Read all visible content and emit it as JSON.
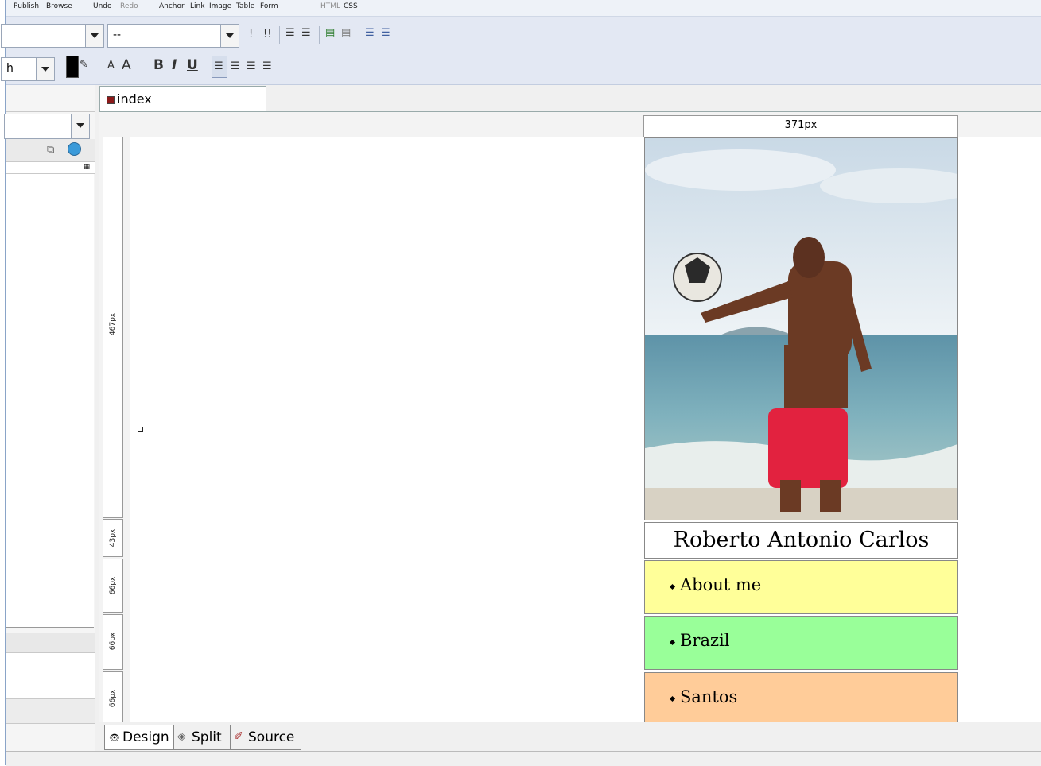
{
  "menubar": {
    "items": [
      {
        "label": "Publish",
        "enabled": true
      },
      {
        "label": "Browse",
        "enabled": true
      },
      {
        "label": "Undo",
        "enabled": true
      },
      {
        "label": "Redo",
        "enabled": false
      },
      {
        "label": "Anchor",
        "enabled": true
      },
      {
        "label": "Link",
        "enabled": true
      },
      {
        "label": "Image",
        "enabled": true
      },
      {
        "label": "Table",
        "enabled": true
      },
      {
        "label": "Form",
        "enabled": true
      },
      {
        "label": "HTML",
        "enabled": false
      },
      {
        "label": "CSS",
        "enabled": true
      }
    ]
  },
  "toolbar1": {
    "style_select_value": "",
    "heading_select_value": "--"
  },
  "toolbar2": {
    "font_select_value": "h",
    "bold_label": "B",
    "italic_label": "I",
    "underline_label": "U",
    "font_size_down": "A",
    "font_size_up": "A",
    "text_color": "#000000"
  },
  "document": {
    "tab_label": "index",
    "width_ruler": "371px",
    "row_rulers": [
      "467px",
      "43px",
      "66px",
      "66px",
      "66px"
    ]
  },
  "page": {
    "name": "Roberto Antonio Carlos",
    "nav": [
      {
        "label": "About me",
        "color": "#ffff99"
      },
      {
        "label": "Brazil",
        "color": "#99ff99"
      },
      {
        "label": "Santos",
        "color": "#ffcc99"
      }
    ]
  },
  "view_tabs": [
    {
      "label": "Design",
      "active": true
    },
    {
      "label": "Split",
      "active": false
    },
    {
      "label": "Source",
      "active": false
    }
  ],
  "status": {
    "text": ""
  }
}
